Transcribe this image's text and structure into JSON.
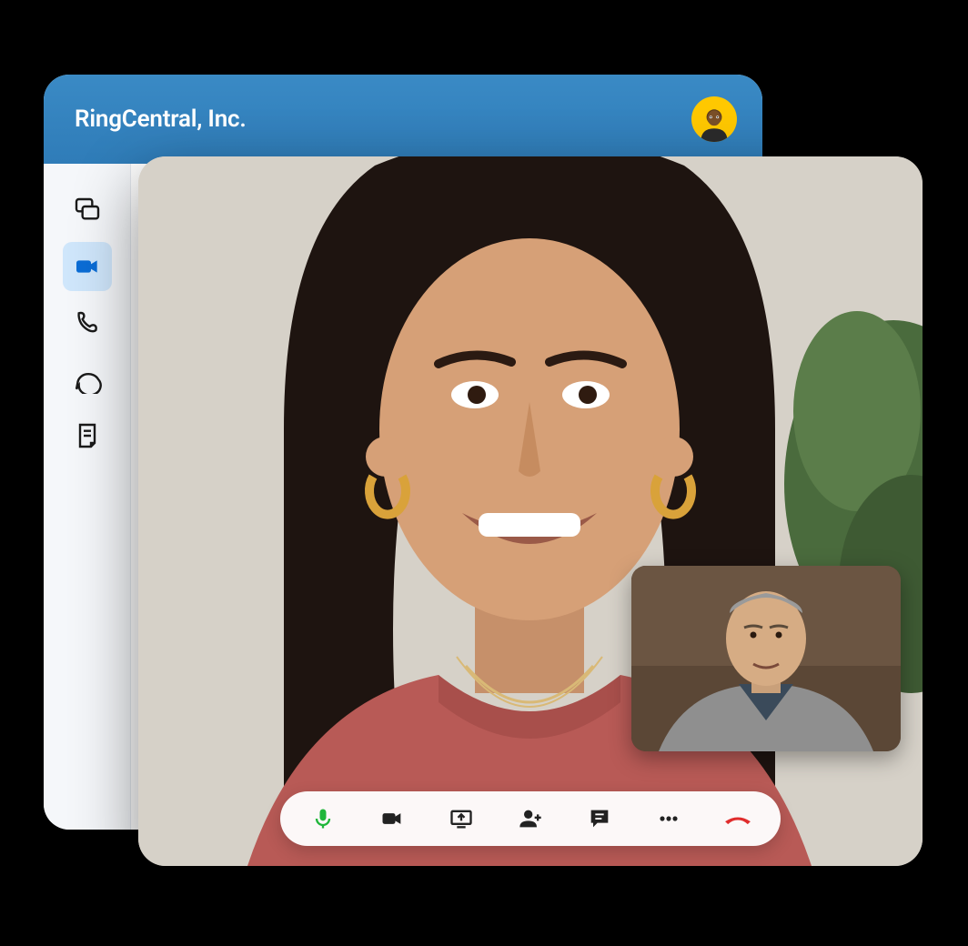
{
  "header": {
    "title": "RingCentral, Inc.",
    "avatar_bg": "#ffc800"
  },
  "sidebar": {
    "items": [
      {
        "name": "messages",
        "active": false
      },
      {
        "name": "video",
        "active": true
      },
      {
        "name": "phone",
        "active": false
      },
      {
        "name": "chat",
        "active": false
      },
      {
        "name": "notes",
        "active": false
      }
    ]
  },
  "video_call": {
    "main_participant": "remote-participant",
    "pip_participant": "self-view",
    "controls": [
      {
        "name": "microphone",
        "state": "on",
        "color": "#1fb63a"
      },
      {
        "name": "camera",
        "state": "on"
      },
      {
        "name": "share-screen",
        "state": "off"
      },
      {
        "name": "add-participant"
      },
      {
        "name": "chat"
      },
      {
        "name": "more"
      },
      {
        "name": "end-call",
        "color": "#e02c2c"
      }
    ]
  },
  "colors": {
    "header_gradient_from": "#3a8ac5",
    "header_gradient_to": "#2f7cb8",
    "sidebar_active_bg": "#cfe6fb",
    "sidebar_active_fg": "#0b6dd6"
  }
}
